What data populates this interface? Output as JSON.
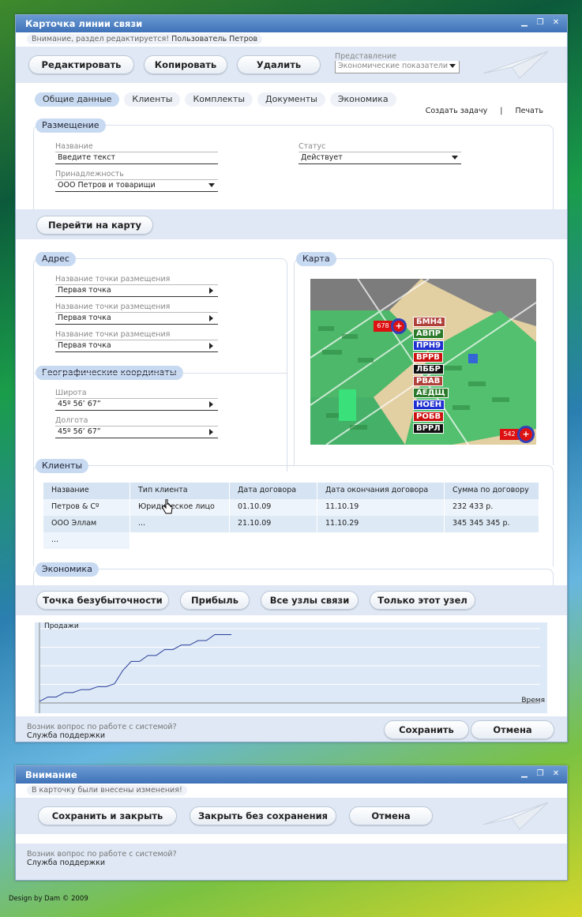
{
  "main_window": {
    "title": "Карточка линии связи",
    "notice": "Внимание, раздел редактируется!",
    "user": "Пользователь Петров",
    "toolbar": {
      "edit": "Редактировать",
      "copy": "Копировать",
      "delete": "Удалить"
    },
    "representation": {
      "label": "Представление",
      "value": "Экономические показатели"
    },
    "tabs": [
      "Общие данные",
      "Клиенты",
      "Комплекты",
      "Документы",
      "Экономика"
    ],
    "links": {
      "create_task": "Создать задачу",
      "separator": "|",
      "print": "Печать"
    },
    "placement": {
      "legend": "Размещение",
      "name_label": "Название",
      "name_value": "Введите текст",
      "status_label": "Статус",
      "status_value": "Действует",
      "belong_label": "Принадлежность",
      "belong_value": "ООО Петров и товарищи",
      "goto_map": "Перейти на карту"
    },
    "address": {
      "legend": "Адрес",
      "points": [
        {
          "label": "Название точки размещения",
          "value": "Первая точка"
        },
        {
          "label": "Название точки размещения",
          "value": "Первая точка"
        },
        {
          "label": "Название точки размещения",
          "value": "Первая точка"
        }
      ]
    },
    "geo": {
      "legend": "Географические координаты",
      "lat_label": "Широта",
      "lat_value": "45º 56’ 67”",
      "lon_label": "Долгота",
      "lon_value": "45º 56’ 67”"
    },
    "map": {
      "legend": "Карта",
      "marker1": "678",
      "marker2": "542",
      "tags": [
        {
          "text": "БМН4",
          "color": "#b0403a"
        },
        {
          "text": "АВПР",
          "color": "#2a7a2a"
        },
        {
          "text": "ПРН9",
          "color": "#1f2fd0"
        },
        {
          "text": "ВРРВ",
          "color": "#cc1111"
        },
        {
          "text": "ЛББР",
          "color": "#111111"
        },
        {
          "text": "РВАВ",
          "color": "#b0403a"
        },
        {
          "text": "АЕДЩ",
          "color": "#2a7a2a"
        },
        {
          "text": "НОЕН",
          "color": "#1f2fd0"
        },
        {
          "text": "РОБВ",
          "color": "#cc1111"
        },
        {
          "text": "ВРРЛ",
          "color": "#111111"
        }
      ]
    },
    "clients": {
      "legend": "Клиенты",
      "headers": [
        "Название",
        "Тип клиента",
        "Дата договора",
        "Дата окончания договора",
        "Сумма по договору"
      ],
      "rows": [
        [
          "Петров & Сº",
          "Юридическое лицо",
          "01.10.09",
          "11.10.19",
          "232 433 р."
        ],
        [
          "ООО Эллам",
          "...",
          "21.10.09",
          "11.10.29",
          "345 345 345 р."
        ]
      ],
      "more": "..."
    },
    "economics": {
      "legend": "Экономика",
      "buttons": [
        "Точка безубыточности",
        "Прибыль",
        "Все узлы связи",
        "Только этот узел"
      ],
      "y_label": "Продажи",
      "x_label": "Время"
    },
    "footer": {
      "question": "Возник вопрос по работе с системой?",
      "support": "Служба поддержки",
      "save": "Сохранить",
      "cancel": "Отмена"
    }
  },
  "dialog": {
    "title": "Внимание",
    "notice": "В карточку были внесены изменения!",
    "save_close": "Сохранить и закрыть",
    "close_nosave": "Закрыть без сохранения",
    "cancel": "Отмена",
    "footer": {
      "question": "Возник вопрос по работе с системой?",
      "support": "Служба поддержки"
    }
  },
  "credit": "Design by Dam © 2009",
  "chart_data": {
    "type": "line",
    "title": "",
    "xlabel": "Время",
    "ylabel": "Продажи",
    "x": [
      0,
      1,
      2,
      3,
      4,
      5,
      6,
      7,
      8,
      9,
      10,
      11,
      12,
      13,
      14,
      15,
      16,
      17,
      18,
      19,
      20,
      21,
      22,
      23
    ],
    "values": [
      2,
      8,
      8,
      14,
      14,
      18,
      18,
      22,
      22,
      26,
      44,
      56,
      56,
      64,
      64,
      72,
      72,
      78,
      78,
      84,
      84,
      92,
      92,
      92
    ],
    "xlim": [
      0,
      60
    ],
    "ylim": [
      0,
      100
    ],
    "grid": true
  }
}
